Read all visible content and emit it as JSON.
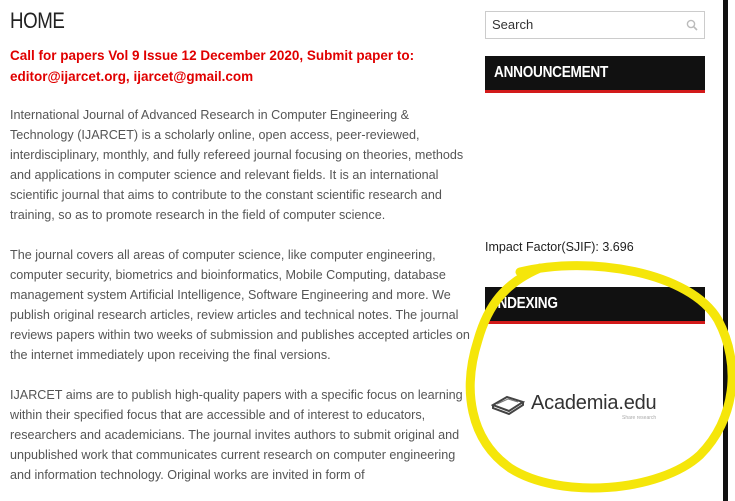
{
  "main": {
    "title": "HOME",
    "call_for_papers": "Call for papers Vol 9 Issue 12 December 2020, Submit paper to: editor@ijarcet.org, ijarcet@gmail.com",
    "paragraphs": [
      "International Journal of Advanced Research in Computer Engineering & Technology (IJARCET) is a scholarly online, open access, peer-reviewed, interdisciplinary, monthly, and fully refereed journal focusing on theories, methods and applications in computer science and relevant fields. It is an international scientific journal that aims to contribute to the constant scientific research and training, so as to promote research in the field of computer science.",
      "The journal covers all areas of computer science, like computer engineering, computer security, biometrics and bioinformatics, Mobile Computing, database management system Artificial Intelligence, Software Engineering and more. We publish original research articles, review articles and technical notes. The journal reviews papers within two weeks of submission and publishes accepted articles on the internet immediately upon receiving the final versions.",
      "IJARCET aims are to publish high-quality papers with a specific focus on learning within their specified focus that are accessible and of interest to educators, researchers and academicians. The journal invites authors to submit original and unpublished work that communicates current research on computer engineering and information technology. Original works are invited in form of"
    ]
  },
  "sidebar": {
    "search_placeholder": "Search",
    "announcement_heading": "ANNOUNCEMENT",
    "impact_factor": "Impact Factor(SJIF): 3.696",
    "indexing_heading": "INDEXING",
    "academia_text": "Academia.edu",
    "academia_subtext": "Share research"
  },
  "colors": {
    "call_text": "#e00000",
    "heading_bg": "#111111",
    "heading_accent": "#d21a1a",
    "highlight": "#f5e60a"
  }
}
